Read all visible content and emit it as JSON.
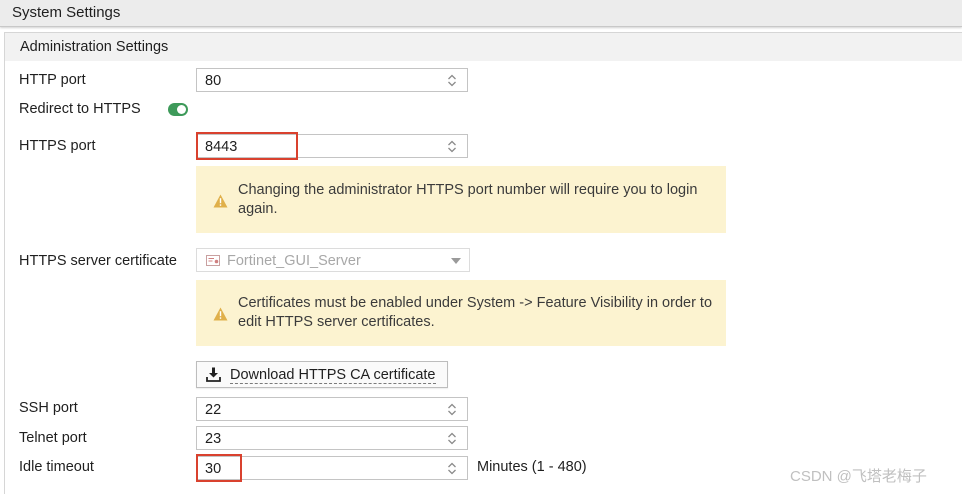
{
  "window": {
    "title": "System Settings"
  },
  "section": {
    "title": "Administration Settings"
  },
  "http_port": {
    "label": "HTTP port",
    "value": "80"
  },
  "redirect": {
    "label": "Redirect to HTTPS",
    "enabled": true
  },
  "https_port": {
    "label": "HTTPS port",
    "value": "8443",
    "warning": "Changing the administrator HTTPS port number will require you to login again."
  },
  "https_cert": {
    "label": "HTTPS server certificate",
    "value": "Fortinet_GUI_Server",
    "warning": "Certificates must be enabled under System -> Feature Visibility in order to edit HTTPS server certificates.",
    "download_label": "Download HTTPS CA certificate"
  },
  "ssh_port": {
    "label": "SSH port",
    "value": "22"
  },
  "telnet_port": {
    "label": "Telnet port",
    "value": "23"
  },
  "idle_timeout": {
    "label": "Idle timeout",
    "value": "30",
    "units": "Minutes (1 - 480)"
  },
  "watermark": "CSDN @飞塔老梅子",
  "colors": {
    "highlight": "#d9412e",
    "warning_bg": "#fcf3d0",
    "toggle_on": "#3e9a5a",
    "warning_icon": "#e0b04a"
  }
}
